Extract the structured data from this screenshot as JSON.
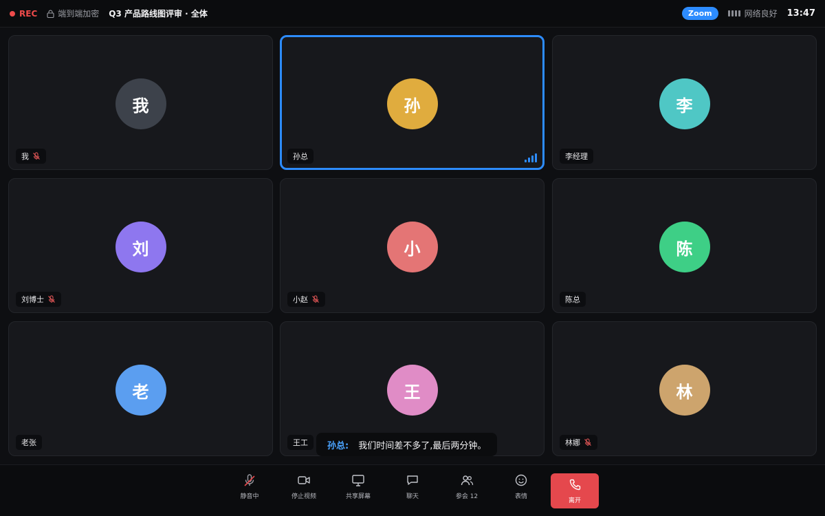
{
  "topbar": {
    "rec_label": "REC",
    "encryption_label": "端到端加密",
    "meeting_title": "Q3 产品路线图评审 · 全体",
    "app_badge": "Zoom",
    "network_label": "网络良好",
    "clock": "13:47"
  },
  "participants": [
    {
      "initial": "我",
      "name": "我",
      "color": "#3d424b",
      "muted": true,
      "speaking": false
    },
    {
      "initial": "孙",
      "name": "孙总",
      "color": "#e0ac3e",
      "muted": false,
      "speaking": true
    },
    {
      "initial": "李",
      "name": "李经理",
      "color": "#4fc7c5",
      "muted": false,
      "speaking": false
    },
    {
      "initial": "刘",
      "name": "刘博士",
      "color": "#8e77ef",
      "muted": true,
      "speaking": false
    },
    {
      "initial": "小",
      "name": "小赵",
      "color": "#e47575",
      "muted": true,
      "speaking": false
    },
    {
      "initial": "陈",
      "name": "陈总",
      "color": "#3ecf86",
      "muted": false,
      "speaking": false
    },
    {
      "initial": "老",
      "name": "老张",
      "color": "#5b9ef0",
      "muted": false,
      "speaking": false
    },
    {
      "initial": "王",
      "name": "王工",
      "color": "#e08cc6",
      "muted": false,
      "speaking": false
    },
    {
      "initial": "林",
      "name": "林娜",
      "color": "#cda46d",
      "muted": true,
      "speaking": false
    }
  ],
  "caption": {
    "speaker": "孙总:",
    "text": "我们时间差不多了,最后两分钟。"
  },
  "toolbar": {
    "mute_label": "静音中",
    "video_label": "停止视频",
    "share_label": "共享屏幕",
    "chat_label": "聊天",
    "participants_label": "参会 12",
    "reactions_label": "表情",
    "leave_label": "离开"
  },
  "colors": {
    "accent": "#2d8cff",
    "danger": "#e5484d",
    "rec": "#ef4b4b"
  }
}
